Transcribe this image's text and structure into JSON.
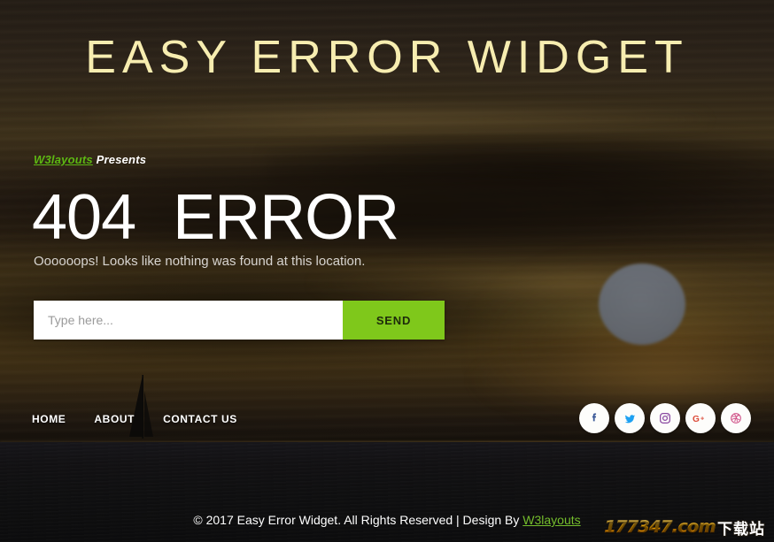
{
  "site": {
    "title": "EASY ERROR WIDGET",
    "title_color": "#f7edb0"
  },
  "hero": {
    "presents_brand": "W3layouts",
    "presents_word": "Presents",
    "brand_color": "#5db812",
    "error_code": "404",
    "error_word": "ERROR",
    "subtitle": "Oooooops! Looks like nothing was found at this location."
  },
  "search": {
    "placeholder": "Type here...",
    "value": "",
    "send_label": "SEND",
    "send_color": "#7fc81b"
  },
  "nav": {
    "items": [
      {
        "label": "HOME",
        "name": "nav-item-home"
      },
      {
        "label": "ABOUT",
        "name": "nav-item-about"
      },
      {
        "label": "CONTACT  US",
        "name": "nav-item-contact-us"
      }
    ]
  },
  "social": {
    "items": [
      {
        "name": "facebook-icon",
        "label": "Facebook",
        "color": "#3b5998"
      },
      {
        "name": "twitter-icon",
        "label": "Twitter",
        "color": "#1da1f2"
      },
      {
        "name": "instagram-icon",
        "label": "Instagram",
        "color": "#8a49a1"
      },
      {
        "name": "google-plus-icon",
        "label": "Google Plus",
        "color": "#dc4a38"
      },
      {
        "name": "dribbble-icon",
        "label": "Dribbble",
        "color": "#d1558a"
      }
    ]
  },
  "footer": {
    "text": "© 2017 Easy Error Widget. All Rights Reserved | Design By ",
    "brand": "W3layouts",
    "brand_color": "#74bd2c"
  },
  "watermark": {
    "domain": "177347.com",
    "suffix": "下载站"
  },
  "background": {
    "scene": "sunset-sky-over-sea",
    "sky_top_color": "#33291f",
    "sky_glow_color": "#60491f",
    "sea_color": "#121113",
    "sun_color": "#868d99"
  }
}
